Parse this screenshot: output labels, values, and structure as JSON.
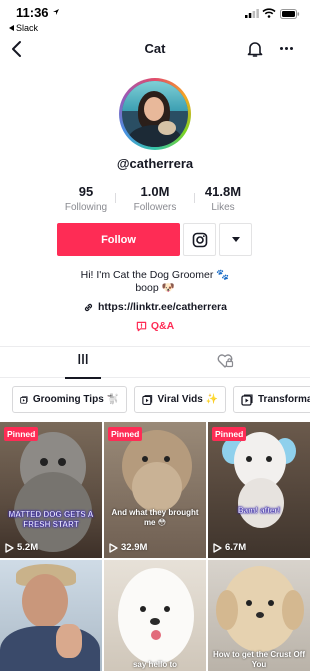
{
  "status_bar": {
    "time": "11:36",
    "back_app": "Slack"
  },
  "nav": {
    "title": "Cat"
  },
  "profile": {
    "username": "@catherrera",
    "stats": [
      {
        "value": "95",
        "label": "Following"
      },
      {
        "value": "1.0M",
        "label": "Followers"
      },
      {
        "value": "41.8M",
        "label": "Likes"
      }
    ],
    "follow_label": "Follow",
    "bio_line1": "Hi! I'm Cat the Dog Groomer 🐾",
    "bio_line2": "boop 🐶",
    "link": "https://linktr.ee/catherrera",
    "qa_label": "Q&A"
  },
  "playlists": [
    {
      "label": "Grooming Tips 🐩"
    },
    {
      "label": "Viral Vids ✨"
    },
    {
      "label": "Transformat"
    }
  ],
  "videos": [
    {
      "pinned": "Pinned",
      "views": "5.2M",
      "caption": "MATTED DOG GETS A FRESH START"
    },
    {
      "pinned": "Pinned",
      "views": "32.9M",
      "caption": "And what they brought me 😳"
    },
    {
      "pinned": "Pinned",
      "views": "6.7M",
      "caption": "Bam! after!"
    },
    {
      "caption": ""
    },
    {
      "caption": "say hello to"
    },
    {
      "caption": "How to get the Crust Off You"
    }
  ],
  "colors": {
    "accent": "#fe2c55",
    "text": "#161823",
    "muted": "#8a8b91"
  }
}
